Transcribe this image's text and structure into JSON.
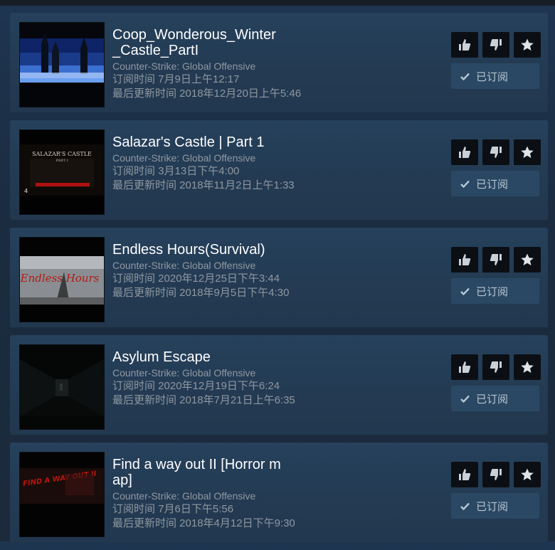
{
  "items": [
    {
      "title": "Coop_Wonderous_Winter_Castle_PartI",
      "game": "Counter-Strike: Global Offensive",
      "subscribed": "订阅时间 7月9日上午12:17",
      "updated": "最后更新时间 2018年12月20日上午5:46",
      "subscribe_label": "已订阅",
      "thumb_icon": "winter-castle-thumbnail"
    },
    {
      "title": "Salazar's Castle | Part 1",
      "game": "Counter-Strike: Global Offensive",
      "subscribed": "订阅时间 3月13日下午4:00",
      "updated": "最后更新时间 2018年11月2日上午1:33",
      "subscribe_label": "已订阅",
      "thumb_title": "SALAZAR'S CASTLE",
      "thumb_sub": "PART I",
      "thumb_tag": "4"
    },
    {
      "title": "Endless Hours(Survival)",
      "game": "Counter-Strike: Global Offensive",
      "subscribed": "订阅时间 2020年12月25日下午3:44",
      "updated": "最后更新时间 2018年9月5日下午4:30",
      "subscribe_label": "已订阅",
      "thumb_title": "Endless Hours"
    },
    {
      "title": "Asylum Escape",
      "game": "Counter-Strike: Global Offensive",
      "subscribed": "订阅时间 2020年12月19日下午6:24",
      "updated": "最后更新时间 2018年7月21日上午6:35",
      "subscribe_label": "已订阅"
    },
    {
      "title": "Find a way out II [Horror map]",
      "game": "Counter-Strike: Global Offensive",
      "subscribed": "订阅时间 7月6日下午5:56",
      "updated": "最后更新时间 2018年4月12日下午9:30",
      "subscribe_label": "已订阅",
      "thumb_title": "FIND A WAY OUT II"
    }
  ],
  "colors": {
    "page_bg": "#1b2c40",
    "card_bg": "#233a52",
    "title": "#ffffff",
    "muted": "#8f98a0",
    "action_bg": "#0b0f14",
    "subscribe_bg": "#2a4863"
  }
}
